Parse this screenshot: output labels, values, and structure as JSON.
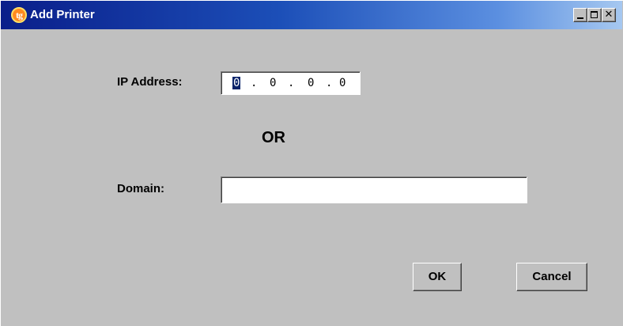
{
  "window": {
    "title": "Add Printer",
    "icon": "tg-app-icon",
    "icon_text": "tg",
    "title_gradient": [
      "#0a1e8a",
      "#a6c8f0"
    ]
  },
  "titlebar_buttons": {
    "minimize_icon": "minimize-icon",
    "maximize_icon": "maximize-icon",
    "close_icon": "close-icon",
    "close_glyph": "✕"
  },
  "form": {
    "ip_label": "IP Address:",
    "ip_octets": [
      "0",
      "0",
      "0",
      "0"
    ],
    "ip_separator": ".",
    "or_label": "OR",
    "domain_label": "Domain:",
    "domain_value": ""
  },
  "buttons": {
    "ok_label": "OK",
    "cancel_label": "Cancel"
  }
}
